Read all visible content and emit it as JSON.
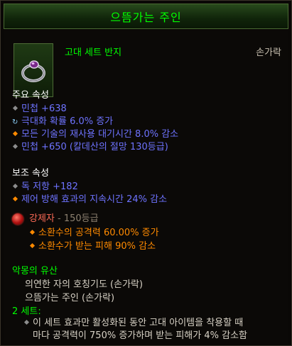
{
  "header": {
    "title": "으뜸가는 주인"
  },
  "item": {
    "icon": "ring-icon",
    "type": "고대 세트 반지",
    "slot": "손가락"
  },
  "primary": {
    "heading": "주요 속성",
    "stats": [
      {
        "text": "민첩 +638"
      },
      {
        "text": "극대화 확률 6.0% 증가"
      },
      {
        "text": "모든 기술의 재사용 대기시간 8.0% 감소"
      },
      {
        "text": "민첩 +650 (칼데산의 절망 130등급)"
      }
    ]
  },
  "secondary": {
    "heading": "보조 속성",
    "stats": [
      {
        "text": "독 저항 +182"
      },
      {
        "text": "제어 방해 효과의 지속시간 24% 감소"
      }
    ]
  },
  "gem": {
    "name": "강제자",
    "rank": " - 150등급",
    "effects": [
      "소환수의 공격력 60.00% 증가",
      "소환수가 받는 피해 90% 감소"
    ]
  },
  "set": {
    "name": "악몽의 유산",
    "pieces": [
      "의연한 자의 호칭기도 (손가락)",
      "으뜸가는 주인 (손가락)"
    ],
    "bonus_label": "2 세트:",
    "bonus_line1": "이 세트 효과만 활성화된 동안 고대 아이템을 착용할 때",
    "bonus_line2": "마다 공격력이 750% 증가하며 받는 피해가 4% 감소함"
  },
  "colors": {
    "title_green": "#00ff00",
    "stat_blue": "#6e73ff",
    "legendary_orange": "#ff8a00",
    "gem_red": "#ff6b57"
  }
}
